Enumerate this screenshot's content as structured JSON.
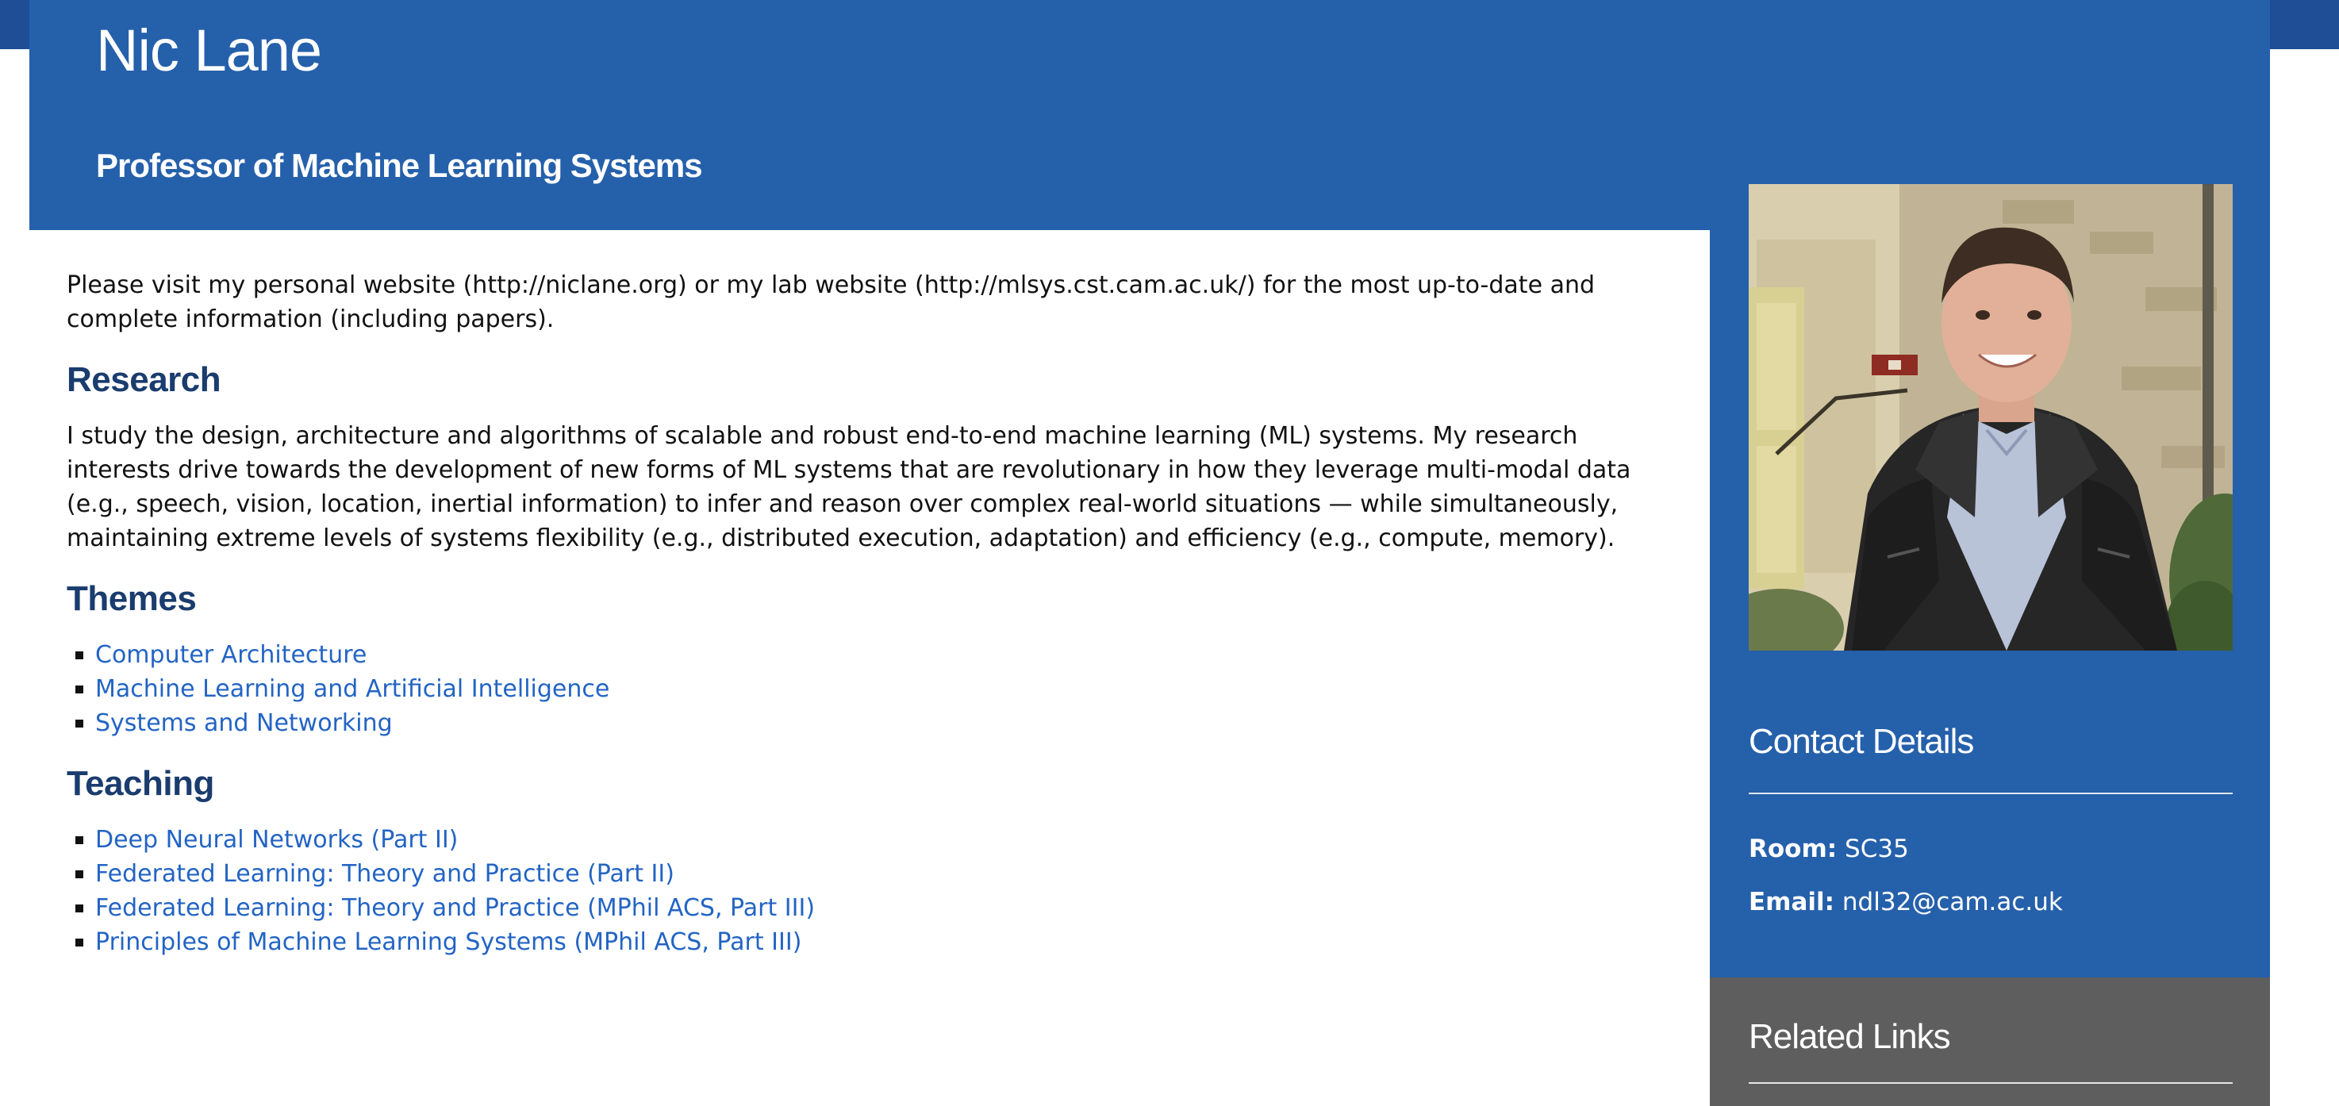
{
  "header": {
    "name": "Nic Lane",
    "title": "Professor of Machine Learning Systems"
  },
  "intro": "Please visit my personal website (http://niclane.org) or my lab website (http://mlsys.cst.cam.ac.uk/) for the most up-to-date and complete information (including papers).",
  "research": {
    "heading": "Research",
    "text": "I study the design, architecture and algorithms of scalable and robust end-to-end machine learning (ML) systems. My research interests drive towards the development of new forms of ML systems that are revolutionary in how they leverage multi-modal data (e.g., speech, vision, location, inertial information) to infer and reason over complex real-world situations — while simultaneously, maintaining extreme levels of systems flexibility (e.g., distributed execution, adaptation) and efficiency (e.g., compute, memory)."
  },
  "themes": {
    "heading": "Themes",
    "items": [
      "Computer Architecture",
      "Machine Learning and Artificial Intelligence",
      "Systems and Networking"
    ]
  },
  "teaching": {
    "heading": "Teaching",
    "items": [
      "Deep Neural Networks (Part II)",
      "Federated Learning: Theory and Practice (Part II)",
      "Federated Learning: Theory and Practice (MPhil ACS, Part III)",
      "Principles of Machine Learning Systems (MPhil ACS, Part III)"
    ]
  },
  "sidebar": {
    "contact_heading": "Contact Details",
    "room_label": "Room:",
    "room_value": "SC35",
    "email_label": "Email:",
    "email_value": "ndl32@cam.ac.uk",
    "related_heading": "Related Links"
  },
  "colors": {
    "brand_blue": "#2560ab",
    "dark_blue": "#1f4e96",
    "heading_blue": "#1a3c6e",
    "link_blue": "#2364c4",
    "related_gray": "#5e5e5e"
  }
}
